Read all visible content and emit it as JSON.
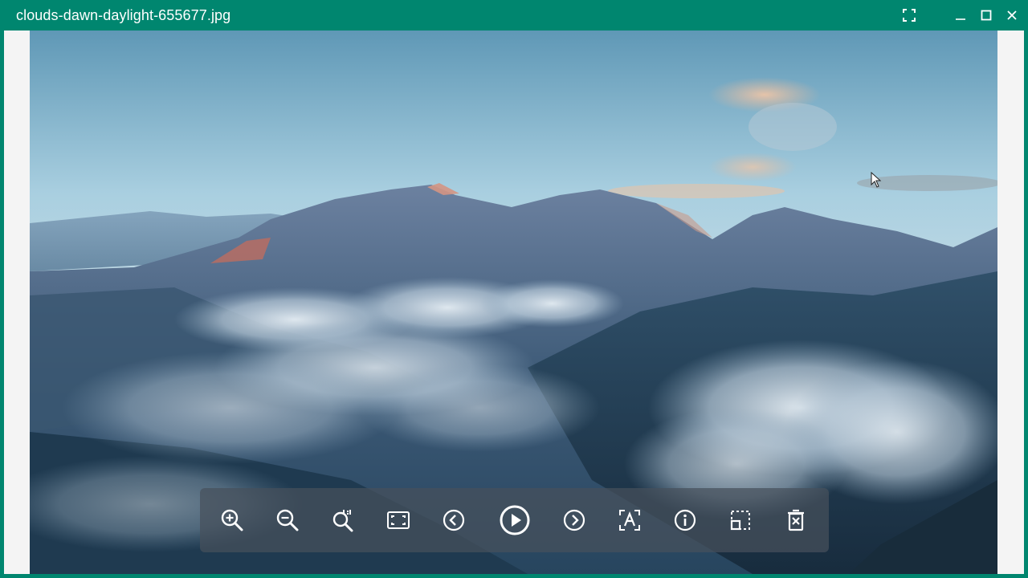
{
  "window": {
    "title": "clouds-dawn-daylight-655677.jpg",
    "accent_color": "#00866f",
    "controls": [
      "fullscreen-icon",
      "minimize-icon",
      "maximize-icon",
      "close-icon"
    ]
  },
  "image": {
    "subject": "mountains above clouds at dawn"
  },
  "toolbar": {
    "buttons": [
      {
        "name": "zoom-in-button",
        "icon": "zoom-in-icon"
      },
      {
        "name": "zoom-out-button",
        "icon": "zoom-out-icon"
      },
      {
        "name": "actual-size-button",
        "icon": "zoom-1to1-icon"
      },
      {
        "name": "fit-to-window-button",
        "icon": "fit-window-icon"
      },
      {
        "name": "previous-button",
        "icon": "chevron-left-circle-icon"
      },
      {
        "name": "slideshow-button",
        "icon": "play-circle-icon"
      },
      {
        "name": "next-button",
        "icon": "chevron-right-circle-icon"
      },
      {
        "name": "ocr-button",
        "icon": "text-recognition-icon"
      },
      {
        "name": "info-button",
        "icon": "info-icon"
      },
      {
        "name": "crop-button",
        "icon": "crop-icon"
      },
      {
        "name": "delete-button",
        "icon": "trash-icon"
      }
    ]
  }
}
